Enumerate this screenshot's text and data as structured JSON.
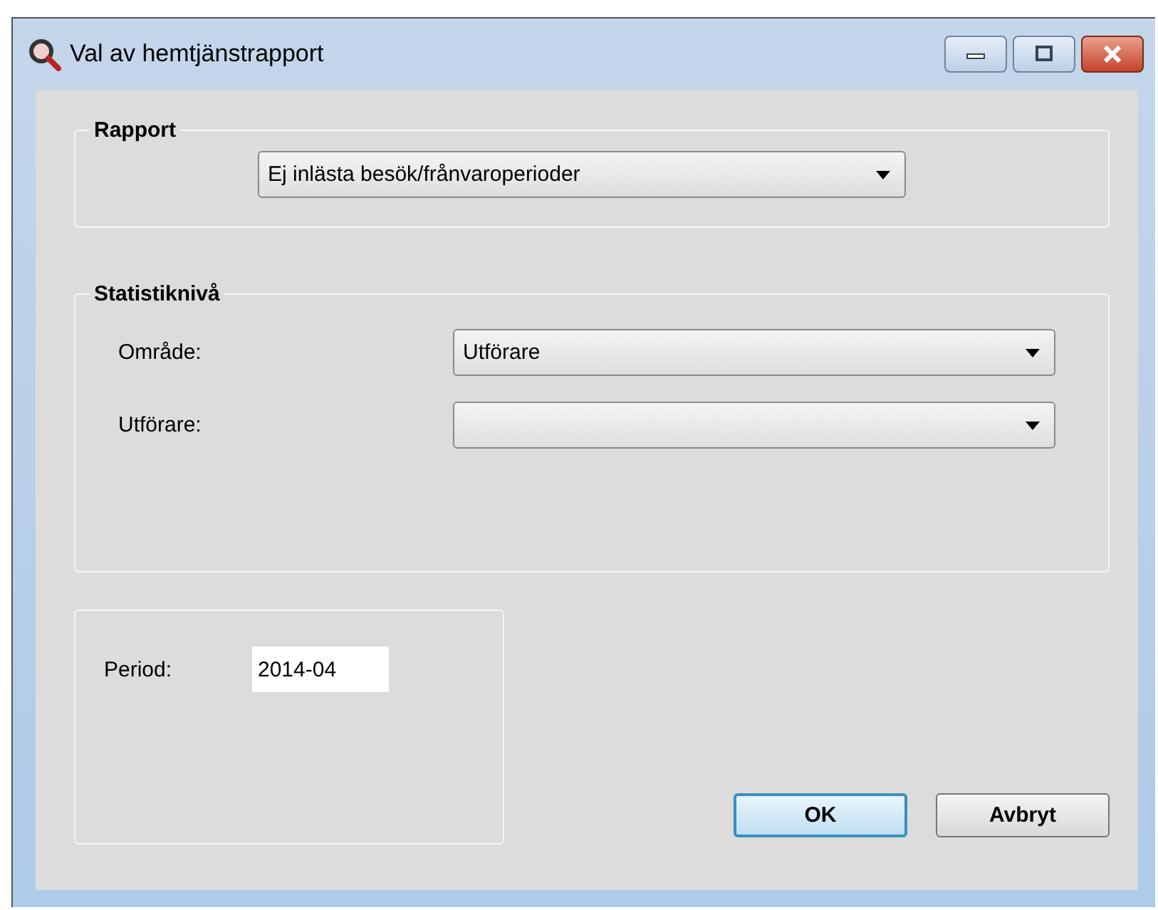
{
  "window": {
    "title": "Val av hemtjänstrapport"
  },
  "report_group": {
    "title": "Rapport",
    "dropdown": {
      "value": "Ej inlästa besök/frånvaroperioder"
    }
  },
  "statistics_group": {
    "title": "Statistiknivå",
    "fields": [
      {
        "label": "Område:",
        "value": "Utförare"
      },
      {
        "label": "Utförare:"
      }
    ]
  },
  "period": {
    "label": "Period:",
    "value": "2014-04"
  },
  "buttons": [
    {
      "label": "OK",
      "default": true
    },
    {
      "label": "Avbryt",
      "default": false
    }
  ]
}
